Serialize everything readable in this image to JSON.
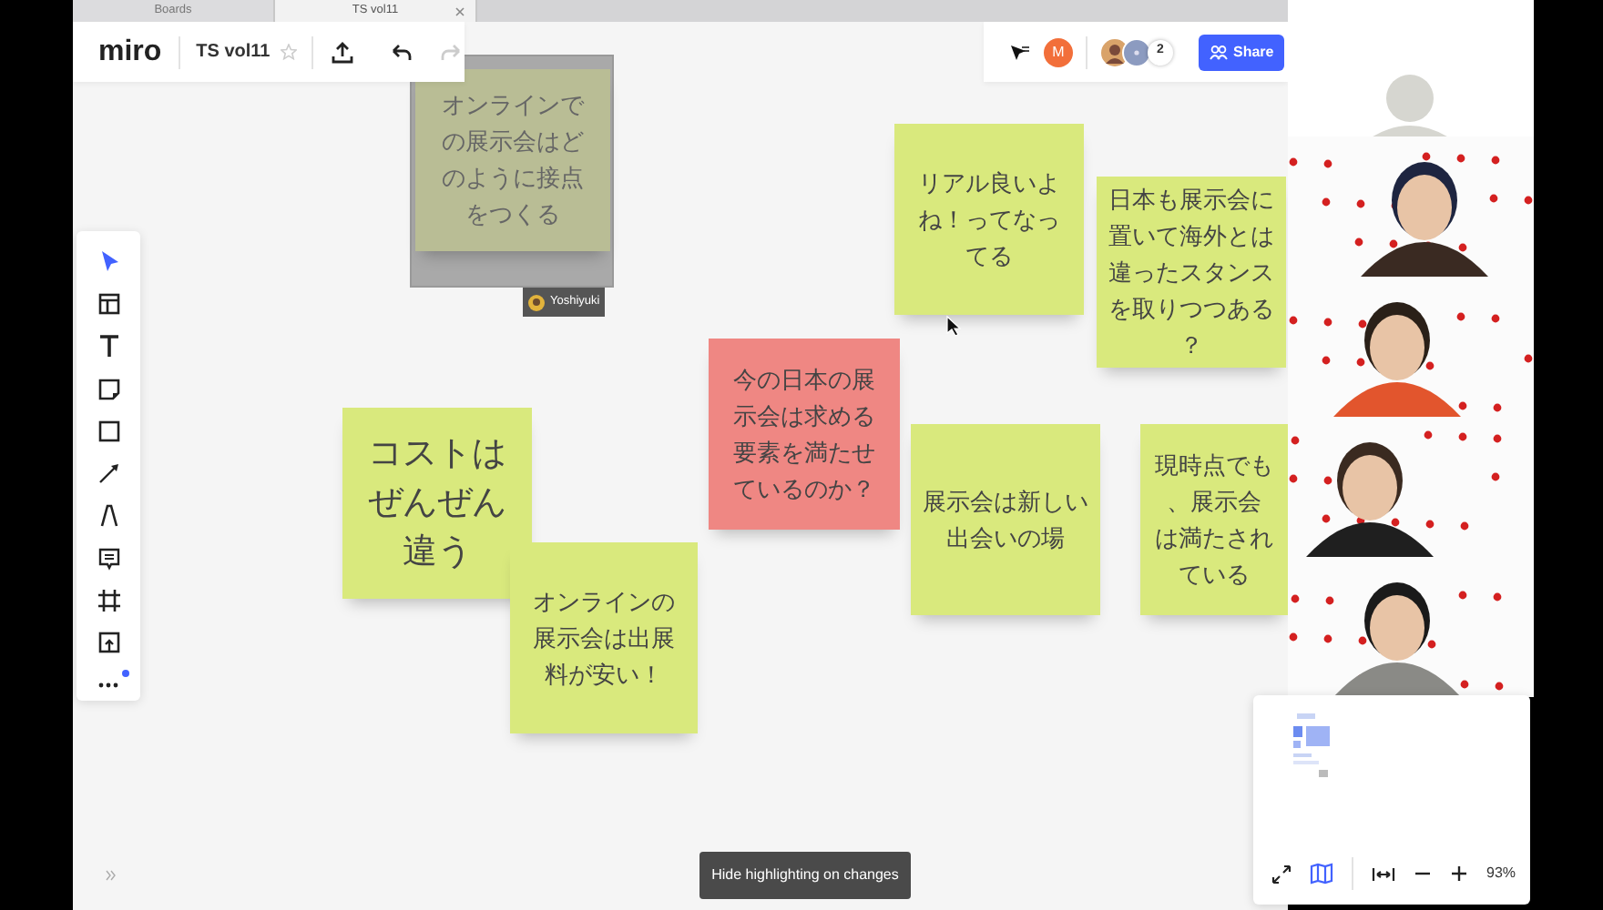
{
  "browser_tabs": [
    {
      "label": "Boards",
      "selected": false
    },
    {
      "label": "TS vol11",
      "selected": true
    }
  ],
  "header": {
    "logo": "miro",
    "board_title": "TS vol11",
    "starred": false,
    "redo_disabled": true
  },
  "collaborators": {
    "own_avatar": "M",
    "count": "2",
    "share": "Share"
  },
  "toolbar": [
    {
      "kind": "select",
      "selected": true
    },
    {
      "kind": "templates",
      "selected": false
    },
    {
      "kind": "text",
      "selected": false
    },
    {
      "kind": "sticky",
      "selected": false
    },
    {
      "kind": "shape",
      "selected": false
    },
    {
      "kind": "line",
      "selected": false
    },
    {
      "kind": "pen",
      "selected": false
    },
    {
      "kind": "comment",
      "selected": false
    },
    {
      "kind": "frame",
      "selected": false
    },
    {
      "kind": "upload",
      "selected": false
    },
    {
      "kind": "more",
      "selected": false,
      "notification": true
    }
  ],
  "notes": [
    {
      "lines": [
        "オンラインで",
        "の展示会はど",
        "のように接点",
        "をつくる"
      ],
      "color": "#b9bd95",
      "highlighted": true,
      "editor": "Yoshiyuki",
      "kind": "normal"
    },
    {
      "lines": [
        "リアル良いよ",
        "ね！ってなっ",
        "てる"
      ],
      "color": "#d9e97d",
      "highlighted": false,
      "kind": "normal"
    },
    {
      "lines": [
        "日本も展示会に",
        "置いて海外とは",
        "違ったスタンス",
        "を取りつつある",
        "？"
      ],
      "color": "#d9e97d",
      "highlighted": false,
      "kind": "normal"
    },
    {
      "lines": [
        "今の日本の展",
        "示会は求める",
        "要素を満たせ",
        "ているのか？"
      ],
      "color": "#ef8783",
      "highlighted": false,
      "kind": "normal"
    },
    {
      "lines": [
        "コストは",
        "ぜんぜん",
        "違う"
      ],
      "color": "#d9e97d",
      "highlighted": false,
      "kind": "large"
    },
    {
      "lines": [
        "オンラインの",
        "展示会は出展",
        "料が安い！"
      ],
      "color": "#d9e97d",
      "highlighted": false,
      "kind": "normal"
    },
    {
      "lines": [
        "展示会は新しい",
        "出会いの場"
      ],
      "color": "#d9e97d",
      "highlighted": false,
      "kind": "normal"
    },
    {
      "lines": [
        "現時点でも",
        "、展示会",
        "は満たされ",
        "ている"
      ],
      "color": "#d9e97d",
      "highlighted": false,
      "kind": "normal"
    }
  ],
  "tooltip": "Hide highlighting on changes",
  "video_tiles": [
    {
      "kind": "avatar"
    },
    {
      "kind": "picture"
    },
    {
      "kind": "picture"
    },
    {
      "kind": "picture"
    },
    {
      "kind": "picture"
    }
  ],
  "minimap": {
    "zoom": "93%",
    "map_on": true
  }
}
